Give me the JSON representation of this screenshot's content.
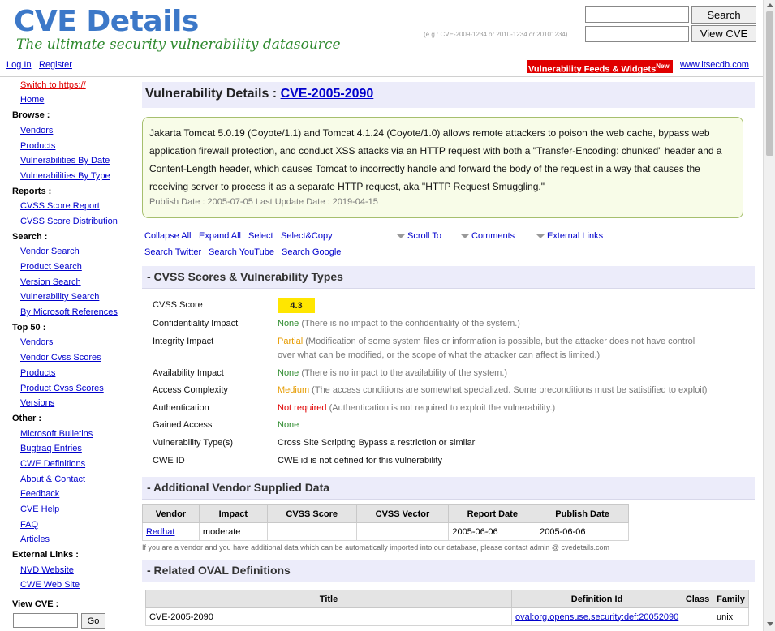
{
  "header": {
    "logo_title": "CVE Details",
    "logo_tagline": "The ultimate security vulnerability datasource",
    "search_button": "Search",
    "viewcve_button": "View CVE",
    "viewcve_hint": "(e.g.: CVE-2009-1234 or 2010-1234 or 20101234)",
    "login": "Log In",
    "register": "Register",
    "feeds_label": "Vulnerability Feeds & Widgets",
    "feeds_new": "New",
    "itsecdb": "www.itsecdb.com"
  },
  "sidebar": {
    "switch_https": "Switch to https://",
    "home": "Home",
    "browse_head": "Browse :",
    "browse": [
      "Vendors",
      "Products",
      "Vulnerabilities By Date",
      "Vulnerabilities By Type"
    ],
    "reports_head": "Reports :",
    "reports": [
      "CVSS Score Report",
      "CVSS Score Distribution"
    ],
    "search_head": "Search :",
    "search": [
      "Vendor Search",
      "Product Search",
      "Version Search",
      "Vulnerability Search",
      "By Microsoft References"
    ],
    "top50_head": "Top 50 :",
    "top50": [
      "Vendors",
      "Vendor Cvss Scores",
      "Products",
      "Product Cvss Scores",
      "Versions"
    ],
    "other_head": "Other :",
    "other": [
      "Microsoft Bulletins",
      "Bugtraq Entries",
      "CWE Definitions",
      "About & Contact",
      "Feedback",
      "CVE Help",
      "FAQ",
      "Articles"
    ],
    "external_head": "External Links :",
    "external": [
      "NVD Website",
      "CWE Web Site"
    ],
    "viewcve_head": "View CVE :",
    "go_button": "Go"
  },
  "main": {
    "title_prefix": "Vulnerability Details : ",
    "cve_id": "CVE-2005-2090",
    "summary": "Jakarta Tomcat 5.0.19 (Coyote/1.1) and Tomcat 4.1.24 (Coyote/1.0) allows remote attackers to poison the web cache, bypass web application firewall protection, and conduct XSS attacks via an HTTP request with both a \"Transfer-Encoding: chunked\" header and a Content-Length header, which causes Tomcat to incorrectly handle and forward the body of the request in a way that causes the receiving server to process it as a separate HTTP request, aka \"HTTP Request Smuggling.\"",
    "dates": "Publish Date : 2005-07-05 Last Update Date : 2019-04-15",
    "toolbar": {
      "collapse_all": "Collapse All",
      "expand_all": "Expand All",
      "select": "Select",
      "select_copy": "Select&Copy",
      "scroll_to": "Scroll To",
      "comments": "Comments",
      "external_links": "External Links",
      "search_twitter": "Search Twitter",
      "search_youtube": "Search YouTube",
      "search_google": "Search Google"
    },
    "cvss_section": "- CVSS Scores & Vulnerability Types",
    "cvss": {
      "score_label": "CVSS Score",
      "score": "4.3",
      "conf_label": "Confidentiality Impact",
      "conf_val": "None",
      "conf_desc": " (There is no impact to the confidentiality of the system.)",
      "integ_label": "Integrity Impact",
      "integ_val": "Partial",
      "integ_desc": " (Modification of some system files or information is possible, but the attacker does not have control over what can be modified, or the scope of what the attacker can affect is limited.)",
      "avail_label": "Availability Impact",
      "avail_val": "None",
      "avail_desc": " (There is no impact to the availability of the system.)",
      "ac_label": "Access Complexity",
      "ac_val": "Medium",
      "ac_desc": " (The access conditions are somewhat specialized. Some preconditions must be satistified to exploit)",
      "auth_label": "Authentication",
      "auth_val": "Not required",
      "auth_desc": " (Authentication is not required to exploit the vulnerability.)",
      "gained_label": "Gained Access",
      "gained_val": "None",
      "vtype_label": "Vulnerability Type(s)",
      "vtype_val": "Cross Site Scripting  Bypass a restriction or similar",
      "cwe_label": "CWE ID",
      "cwe_val": "CWE id is not defined for this vulnerability"
    },
    "vendor_section": "- Additional Vendor Supplied Data",
    "vendor_table": {
      "headers": [
        "Vendor",
        "Impact",
        "CVSS Score",
        "CVSS Vector",
        "Report Date",
        "Publish Date"
      ],
      "row": [
        "Redhat",
        "moderate",
        "",
        "",
        "2005-06-06",
        "2005-06-06"
      ]
    },
    "vendor_note": "If you are a vendor and you have additional data which can be automatically imported into our database, please contact admin @ cvedetails.com",
    "oval_section": "- Related OVAL Definitions",
    "oval_table": {
      "headers": [
        "Title",
        "Definition Id",
        "Class",
        "Family"
      ],
      "row": [
        "CVE-2005-2090",
        "oval:org.opensuse.security:def:20052090",
        "",
        "unix"
      ]
    }
  },
  "colors": {
    "logo_blue": "#3c78c8",
    "tagline_green": "#2f8a2f",
    "section_bg": "#ececfa",
    "summary_bg": "#f8fce8",
    "score_yellow": "#ffe600",
    "red": "#e00000"
  }
}
